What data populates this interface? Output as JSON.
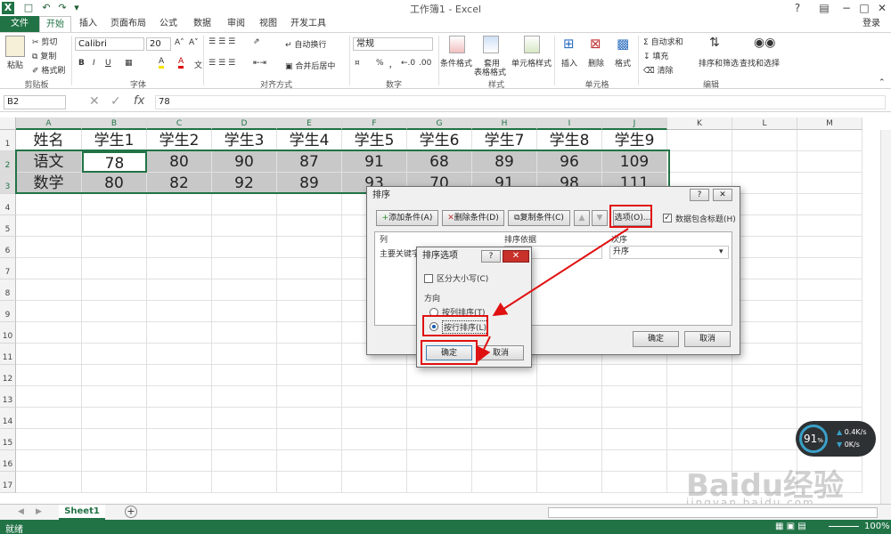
{
  "window": {
    "title": "工作簿1 - Excel",
    "app_icon": "X",
    "login_label": "登录",
    "help_icon": "?",
    "controls": [
      "−",
      "□",
      "✕"
    ]
  },
  "tabs": [
    {
      "label": "文件"
    },
    {
      "label": "开始"
    },
    {
      "label": "插入"
    },
    {
      "label": "页面布局"
    },
    {
      "label": "公式"
    },
    {
      "label": "数据"
    },
    {
      "label": "审阅"
    },
    {
      "label": "视图"
    },
    {
      "label": "开发工具"
    }
  ],
  "ribbon": {
    "clipboard": {
      "paste": "粘贴",
      "cut": "剪切",
      "copy": "复制",
      "format_painter": "格式刷",
      "group": "剪贴板"
    },
    "font": {
      "name": "Calibri",
      "size": "20",
      "grow": "A˄",
      "shrink": "A˅",
      "bold": "B",
      "italic": "I",
      "underline": "U",
      "fill_glyph": "A",
      "color_glyph": "A",
      "char_glyph": "文",
      "group": "字体"
    },
    "alignment": {
      "wrap": "自动换行",
      "merge": "合并后居中",
      "group": "对齐方式"
    },
    "number": {
      "format": "常规",
      "percent": "%",
      "comma": "，",
      "inc": "←.0",
      "dec": ".00",
      "group": "数字"
    },
    "styles": {
      "cond": "条件格式",
      "table1": "套用",
      "table2": "表格格式",
      "cell": "单元格样式",
      "group": "样式"
    },
    "cells": {
      "insert": "插入",
      "delete": "删除",
      "format": "格式",
      "group": "单元格"
    },
    "editing": {
      "autosum": "自动求和",
      "fill": "填充",
      "clear": "清除",
      "sort": "排序和筛选",
      "find": "查找和选择",
      "group": "编辑"
    }
  },
  "formula_bar": {
    "name_box": "B2",
    "fx": "fx",
    "value": "78",
    "cancel": "✕",
    "enter": "✓"
  },
  "grid": {
    "columns": [
      "A",
      "B",
      "C",
      "D",
      "E",
      "F",
      "G",
      "H",
      "I",
      "J",
      "K",
      "L",
      "M"
    ],
    "rows": [
      "1",
      "2",
      "3",
      "4",
      "5",
      "6",
      "7",
      "8",
      "9",
      "10",
      "11",
      "12",
      "13",
      "14",
      "15",
      "16",
      "17"
    ],
    "cells": [
      [
        "姓名",
        "学生1",
        "学生2",
        "学生3",
        "学生4",
        "学生5",
        "学生6",
        "学生7",
        "学生8",
        "学生9"
      ],
      [
        "语文",
        "78",
        "80",
        "90",
        "87",
        "91",
        "68",
        "89",
        "96",
        "109"
      ],
      [
        "数学",
        "80",
        "82",
        "92",
        "89",
        "93",
        "70",
        "91",
        "98",
        "111"
      ]
    ]
  },
  "sort_dialog": {
    "title": "排序",
    "help": "?",
    "close": "✕",
    "add": "添加条件(A)",
    "delete": "删除条件(D)",
    "copy": "复制条件(C)",
    "up": "▲",
    "down": "▼",
    "options": "选项(O)...",
    "header_checkbox": "数据包含标题(H)",
    "col_header": "列",
    "basis_header": "排序依据",
    "order_header": "次序",
    "primary_key": "主要关键字",
    "order_value": "升序",
    "ok": "确定",
    "cancel": "取消"
  },
  "options_dialog": {
    "title": "排序选项",
    "help": "?",
    "close": "✕",
    "case_sensitive": "区分大小写(C)",
    "direction_label": "方向",
    "by_column": "按列排序(T)",
    "by_row": "按行排序(L)",
    "ok": "确定",
    "cancel": "取消"
  },
  "sheetbar": {
    "sheet1": "Sheet1",
    "add": "+",
    "prev": "◀",
    "next": "▶"
  },
  "statusbar": {
    "ready": "就绪",
    "zoom": "100%"
  },
  "net_widget": {
    "percent": "91",
    "unit": "%",
    "up": "0.4K/s",
    "down": "0K/s"
  },
  "watermark": {
    "brand": "Baidu经验",
    "url": "jingyan.baidu.com"
  }
}
